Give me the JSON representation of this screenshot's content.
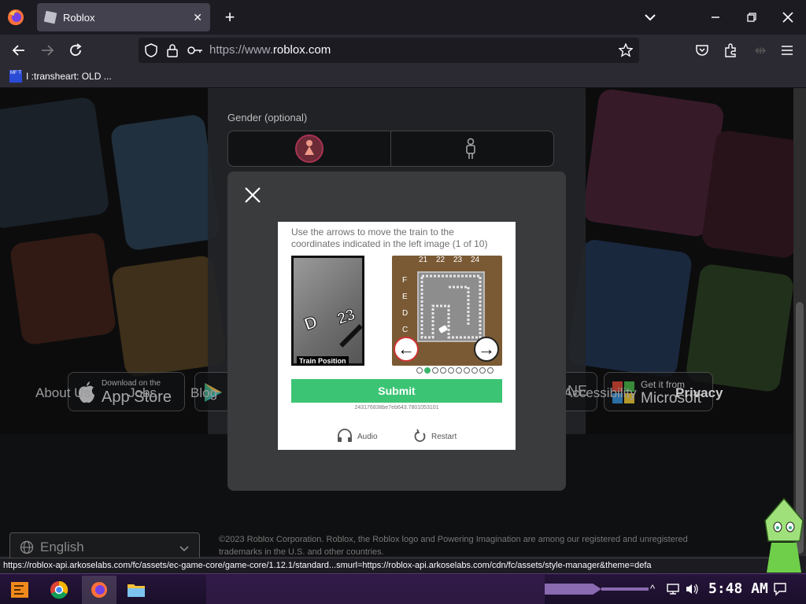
{
  "browser": {
    "tab_title": "Roblox",
    "tab_close": "✕",
    "new_tab": "+",
    "url_prefix": "https://www.",
    "url_domain": "roblox.com",
    "bookmark_label": "I :transheart: OLD ...",
    "bookmark_icon_text": "MF T"
  },
  "page": {
    "gender_label": "Gender (optional)",
    "badges": {
      "appstore_small": "Download on the",
      "appstore_big": "App Store",
      "microsoft_small": "Get it from",
      "microsoft_big": "Microsoft",
      "partial_right": "NE"
    },
    "footer_links": [
      "About Us",
      "Jobs",
      "Blog",
      "Accessibility",
      "Privacy"
    ],
    "language": "English",
    "copyright_line1": "©2023 Roblox Corporation. Roblox, the Roblox logo and Powering Imagination are among our registered and unregistered",
    "copyright_line2": "trademarks in the U.S. and other countries."
  },
  "captcha": {
    "instruction": "Use the arrows to move the train to the coordinates indicated in the left image (1 of 10)",
    "left_image_label": "Train Position",
    "left_image_letter": "D",
    "left_image_number": "23",
    "column_labels": [
      "21",
      "22",
      "23",
      "24"
    ],
    "row_labels": [
      "F",
      "E",
      "D",
      "C"
    ],
    "arrow_left": "←",
    "arrow_right": "→",
    "progress_total": 10,
    "progress_current": 2,
    "submit_label": "Submit",
    "session_id": "243176838be7eb643.7801053101",
    "audio_label": "Audio",
    "restart_label": "Restart"
  },
  "status_url": "https://roblox-api.arkoselabs.com/fc/assets/ec-game-core/game-core/1.12.1/standard...smurl=https://roblox-api.arkoselabs.com/cdn/fc/assets/style-manager&theme=defa",
  "taskbar": {
    "clock": "5:48 AM"
  },
  "colors": {
    "submit": "#3bc474",
    "modal": "#393b3d",
    "page_bg": "#232527"
  }
}
